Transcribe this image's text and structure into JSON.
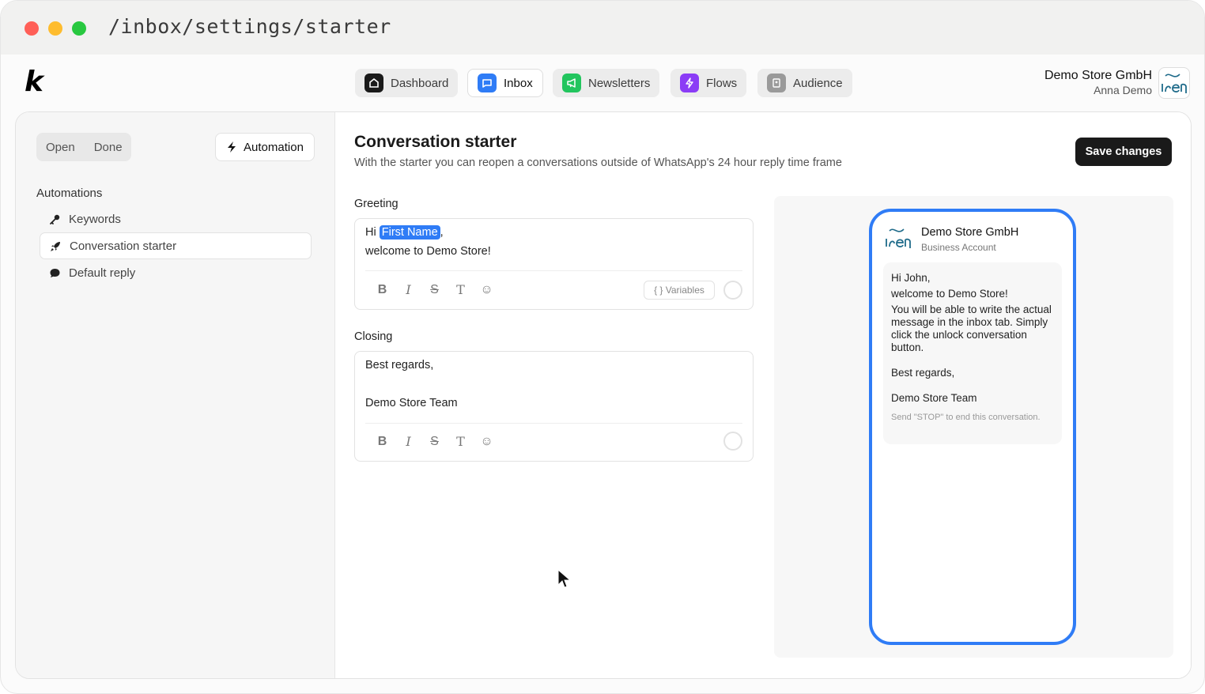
{
  "window": {
    "url": "/inbox/settings/starter"
  },
  "app": {
    "logo": "k",
    "nav": [
      {
        "label": "Dashboard",
        "icon": "dashboard-icon",
        "color": "#1a1a1a",
        "active": false
      },
      {
        "label": "Inbox",
        "icon": "chat-bubble-icon",
        "color": "#2f7cf6",
        "active": true
      },
      {
        "label": "Newsletters",
        "icon": "megaphone-icon",
        "color": "#22c55e",
        "active": false
      },
      {
        "label": "Flows",
        "icon": "lightning-icon",
        "color": "#8b3cf6",
        "active": false
      },
      {
        "label": "Audience",
        "icon": "contacts-icon",
        "color": "#9a9a9a",
        "active": false
      }
    ],
    "account": {
      "name": "Demo Store GmbH",
      "user": "Anna Demo"
    }
  },
  "sidebar": {
    "toggle": [
      "Open",
      "Done"
    ],
    "automation_button": "Automation",
    "section_title": "Automations",
    "items": [
      {
        "label": "Keywords",
        "icon": "key-icon",
        "active": false
      },
      {
        "label": "Conversation starter",
        "icon": "rocket-icon",
        "active": true
      },
      {
        "label": "Default reply",
        "icon": "speech-bubble-icon",
        "active": false
      }
    ]
  },
  "main": {
    "title": "Conversation starter",
    "subtitle": "With the starter you can reopen a conversations outside of WhatsApp's 24 hour reply time frame",
    "save_button": "Save changes",
    "greeting": {
      "label": "Greeting",
      "line1_prefix": "Hi",
      "variable": "First Name",
      "line1_suffix": ",",
      "line2": "welcome to Demo Store!",
      "variables_button": "{ } Variables"
    },
    "closing": {
      "label": "Closing",
      "line1": "Best regards,",
      "line2": "Demo Store Team"
    },
    "toolbar": [
      "B",
      "I",
      "S",
      "T",
      "☺"
    ]
  },
  "preview": {
    "business_name": "Demo Store GmbH",
    "account_type": "Business Account",
    "message": {
      "greeting": "Hi John,",
      "welcome": "welcome to Demo Store!",
      "body": "You will be able to write the actual message in the inbox tab. Simply click the unlock conversation button.",
      "closing": "Best regards,",
      "signature": "Demo Store Team",
      "footer": "Send \"STOP\" to end this conversation."
    },
    "accent_color": "#2f7cf6"
  }
}
